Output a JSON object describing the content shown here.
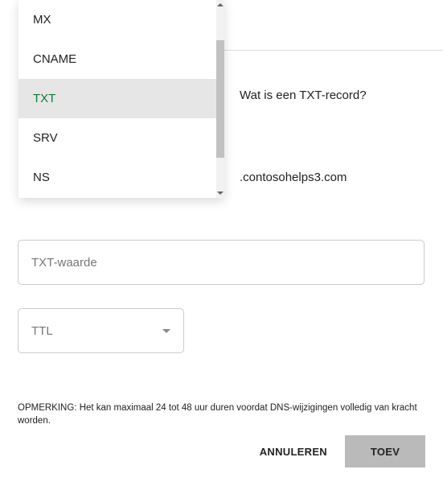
{
  "dropdown": {
    "options": [
      "MX",
      "CNAME",
      "TXT",
      "SRV",
      "NS"
    ],
    "selected_index": 2
  },
  "info_link": "Wat is een TXT-record?",
  "domain": ".contosohelps3.com",
  "txt_value": {
    "placeholder": "TXT-waarde"
  },
  "ttl": {
    "placeholder": "TTL"
  },
  "note": {
    "label": "OPMERKING:",
    "text": "Het kan maximaal 24 tot 48 uur duren voordat DNS-wijzigingen volledig van kracht worden."
  },
  "buttons": {
    "cancel": "ANNULEREN",
    "add": "TOEV"
  }
}
